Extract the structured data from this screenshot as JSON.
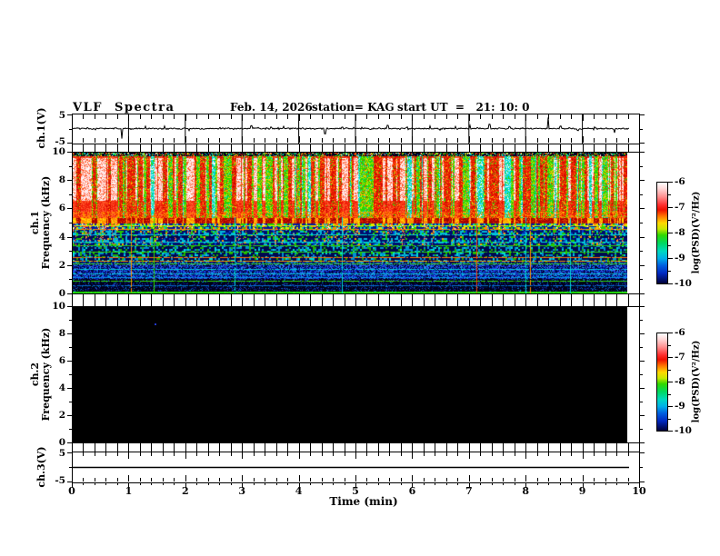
{
  "header": {
    "title": "VLF Spectra",
    "date": "Feb. 14, 2026",
    "station": "station= KAG",
    "start_ut": "start UT  =   21: 10: 0"
  },
  "axes": {
    "x": {
      "label": "Time (min)",
      "ticks": [
        "0",
        "1",
        "2",
        "3",
        "4",
        "5",
        "6",
        "7",
        "8",
        "9",
        "10"
      ],
      "min": 0,
      "max": 10,
      "minor_step_min": 0.2,
      "data_end_min": 9.8
    },
    "p1_y": {
      "label": "ch.1(V)",
      "tick_top": "5",
      "tick_bottom": "-5",
      "min": -5,
      "max": 5
    },
    "p2_y": {
      "label_line1": "ch.1",
      "label_line2": "Frequency (kHz)",
      "ticks": [
        "10",
        "8",
        "6",
        "4",
        "2",
        "0"
      ],
      "min": 0,
      "max": 10
    },
    "p3_y": {
      "label_line1": "ch.2",
      "label_line2": "Frequency (kHz)",
      "ticks": [
        "10",
        "8",
        "6",
        "4",
        "2",
        "0"
      ],
      "min": 0,
      "max": 10
    },
    "p4_y": {
      "label": "ch.3(V)",
      "tick_top": "5",
      "tick_bottom": "-5",
      "min": -5,
      "max": 5
    }
  },
  "colorbar": {
    "ticks": [
      "-6",
      "-7",
      "-8",
      "-9",
      "-10"
    ],
    "label": "log(PSD)(V²/Hz)",
    "z_min": -10,
    "z_max": -6,
    "gradient": [
      {
        "pos": 0.0,
        "color": "#ffffff"
      },
      {
        "pos": 0.06,
        "color": "#ffd8d8"
      },
      {
        "pos": 0.14,
        "color": "#ff9090"
      },
      {
        "pos": 0.22,
        "color": "#ff3030"
      },
      {
        "pos": 0.27,
        "color": "#ee1000"
      },
      {
        "pos": 0.33,
        "color": "#ff7000"
      },
      {
        "pos": 0.4,
        "color": "#ffd800"
      },
      {
        "pos": 0.46,
        "color": "#c8e800"
      },
      {
        "pos": 0.52,
        "color": "#30d800"
      },
      {
        "pos": 0.6,
        "color": "#00d860"
      },
      {
        "pos": 0.68,
        "color": "#00d8c0"
      },
      {
        "pos": 0.75,
        "color": "#00b0e8"
      },
      {
        "pos": 0.82,
        "color": "#0060e0"
      },
      {
        "pos": 0.9,
        "color": "#0028c0"
      },
      {
        "pos": 1.0,
        "color": "#000038"
      }
    ]
  },
  "chart_data": [
    {
      "type": "line",
      "name": "ch1_voltage_waveform",
      "x_range_min": [
        0,
        10
      ],
      "data_end_min": 9.8,
      "y_range_V": [
        -5,
        5
      ],
      "baseline_V": 0,
      "noise_V": 0.12,
      "gridlines_min": [
        1,
        2,
        3,
        4,
        5,
        6,
        7,
        8,
        9
      ],
      "seed": 20260214,
      "spikes": [
        {
          "t": 0.87,
          "a": -3.4
        },
        {
          "t": 1.28,
          "a": 0.8
        },
        {
          "t": 1.62,
          "a": 0.9
        },
        {
          "t": 2.05,
          "a": -0.6
        },
        {
          "t": 2.6,
          "a": 0.5
        },
        {
          "t": 3.15,
          "a": 1.1
        },
        {
          "t": 3.5,
          "a": 0.7
        },
        {
          "t": 3.72,
          "a": 0.8
        },
        {
          "t": 4.45,
          "a": -1.7
        },
        {
          "t": 4.75,
          "a": 0.6
        },
        {
          "t": 5.1,
          "a": 0.5
        },
        {
          "t": 5.55,
          "a": 0.9
        },
        {
          "t": 5.9,
          "a": 0.6
        },
        {
          "t": 6.3,
          "a": 0.7
        },
        {
          "t": 6.75,
          "a": 0.9
        },
        {
          "t": 7.0,
          "a": 1.1
        },
        {
          "t": 7.35,
          "a": 1.5
        },
        {
          "t": 7.7,
          "a": 0.6
        },
        {
          "t": 8.38,
          "a": 3.9
        },
        {
          "t": 8.6,
          "a": 0.8
        },
        {
          "t": 8.9,
          "a": -0.7
        },
        {
          "t": 9.2,
          "a": 0.6
        },
        {
          "t": 9.55,
          "a": -1.3
        }
      ]
    },
    {
      "type": "heatmap",
      "name": "ch1_spectrogram",
      "x_range_min": [
        0,
        9.8
      ],
      "y_range_kHz": [
        0,
        10
      ],
      "z_label": "log(PSD)(V²/Hz)",
      "z_range": [
        -10,
        -6
      ],
      "seed": 987,
      "persist": 0.52,
      "column_classes": {
        "gap": 0.08,
        "green": 0.26,
        "red": 0.4,
        "hot": 0.26
      },
      "bands": [
        {
          "f": [
            9.75,
            10.0
          ],
          "style": "dark_speckle"
        },
        {
          "f": [
            5.35,
            9.75
          ],
          "style": "streaks"
        },
        {
          "f": [
            4.95,
            5.35
          ],
          "style": "red_band"
        },
        {
          "f": [
            4.5,
            4.95
          ],
          "style": "barcode_bright"
        },
        {
          "f": [
            3.35,
            4.5
          ],
          "style": "barcode_mid"
        },
        {
          "f": [
            2.2,
            3.35
          ],
          "style": "barcode_dim"
        },
        {
          "f": [
            1.0,
            2.2
          ],
          "style": "blue_noise"
        },
        {
          "f": [
            0.15,
            1.0
          ],
          "style": "sparse_dark"
        },
        {
          "f": [
            0.0,
            0.15
          ],
          "style": "green_line"
        }
      ],
      "h_lines": [
        {
          "f": 4.85,
          "color": "#e8e800"
        },
        {
          "f": 4.6,
          "color": "#ff9000"
        },
        {
          "f": 4.2,
          "color": "#00d8d8"
        },
        {
          "f": 3.7,
          "color": "#00d8d8"
        },
        {
          "f": 3.45,
          "color": "#30c800"
        },
        {
          "f": 3.0,
          "color": "#30e000"
        },
        {
          "f": 2.6,
          "color": "#ff7000"
        },
        {
          "f": 2.35,
          "color": "#ff9000"
        },
        {
          "f": 2.1,
          "color": "#30e000"
        },
        {
          "f": 1.75,
          "color": "#00c8d8"
        },
        {
          "f": 1.45,
          "color": "#00c8d8"
        },
        {
          "f": 1.15,
          "color": "#0090e0"
        },
        {
          "f": 0.9,
          "color": "#30d800"
        },
        {
          "f": 0.6,
          "color": "#0070c8"
        }
      ],
      "v_marks": [
        {
          "t": 1.03,
          "color": "#ff9000"
        },
        {
          "t": 1.42,
          "color": "#30e000"
        },
        {
          "t": 2.85,
          "color": "#00d8d8"
        },
        {
          "t": 4.75,
          "color": "#00d8d8"
        },
        {
          "t": 7.11,
          "color": "#ff4000"
        },
        {
          "t": 7.98,
          "color": "#00d8d8"
        },
        {
          "t": 8.06,
          "color": "#ff9000"
        },
        {
          "t": 8.77,
          "color": "#00d8d8"
        }
      ]
    },
    {
      "type": "heatmap",
      "name": "ch2_spectrogram",
      "x_range_min": [
        0,
        9.8
      ],
      "y_range_kHz": [
        0,
        10
      ],
      "z_range": [
        -10,
        -6
      ],
      "note": "no signal - uniform black (below -10 floor)",
      "background": "#000000",
      "speckles": [
        {
          "t": 1.45,
          "f": 8.8,
          "color": "#2238c8"
        }
      ]
    },
    {
      "type": "line",
      "name": "ch3_voltage_waveform",
      "x_range_min": [
        0,
        9.8
      ],
      "y_range_V": [
        -5,
        5
      ],
      "constant_V": 0
    }
  ]
}
